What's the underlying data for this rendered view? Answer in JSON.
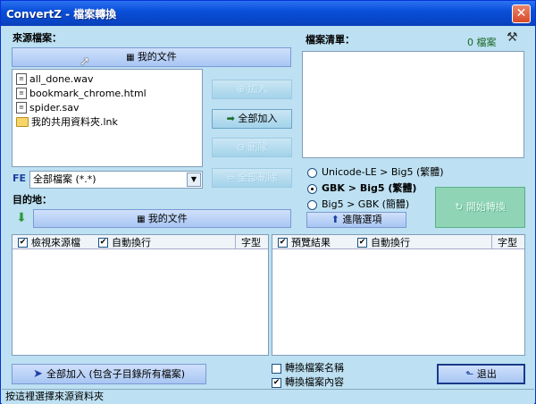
{
  "window": {
    "title": "ConvertZ - 檔案轉換",
    "close_glyph": "✕"
  },
  "source": {
    "label": "來源檔案：",
    "folder_button": "我的文件",
    "files": [
      {
        "name": "all_done.wav",
        "icon": "file-icon"
      },
      {
        "name": "bookmark_chrome.html",
        "icon": "file-icon"
      },
      {
        "name": "spider.sav",
        "icon": "file-icon"
      },
      {
        "name": "我的共用資料夾.lnk",
        "icon": "folder-icon"
      }
    ],
    "filter_badge": "FE",
    "filter_value": "全部檔案 (*.*)"
  },
  "actions": {
    "add": "加入",
    "add_all": "全部加入",
    "remove": "刪除",
    "remove_all": "全部刪除"
  },
  "file_list": {
    "label": "檔案清單：",
    "count": "0 檔案"
  },
  "encoding": {
    "options": [
      {
        "label": "Unicode-LE > Big5 (繁體)",
        "selected": false
      },
      {
        "label": "GBK > Big5 (繁體)",
        "selected": true
      },
      {
        "label": "Big5 > GBK (簡體)",
        "selected": false
      }
    ],
    "advanced": "進階選項",
    "start": "開始轉換"
  },
  "dest": {
    "label": "目的地：",
    "folder_button": "我的文件"
  },
  "left_panel": {
    "view_source": "檢視來源檔",
    "word_wrap": "自動換行",
    "font": "字型"
  },
  "right_panel": {
    "preview": "預覽結果",
    "word_wrap": "自動換行",
    "font": "字型"
  },
  "bottom": {
    "add_all_sub": "全部加入 (包含子目錄所有檔案)",
    "convert_name": "轉換檔案名稱",
    "convert_name_checked": false,
    "convert_content": "轉換檔案內容",
    "convert_content_checked": true,
    "exit": "退出"
  },
  "status": "按這裡選擇來源資料夾",
  "colors": {
    "title_bar": "#0a4fd8",
    "window_bg": "#bde0f2",
    "button_blue": "#a8c6f3"
  }
}
